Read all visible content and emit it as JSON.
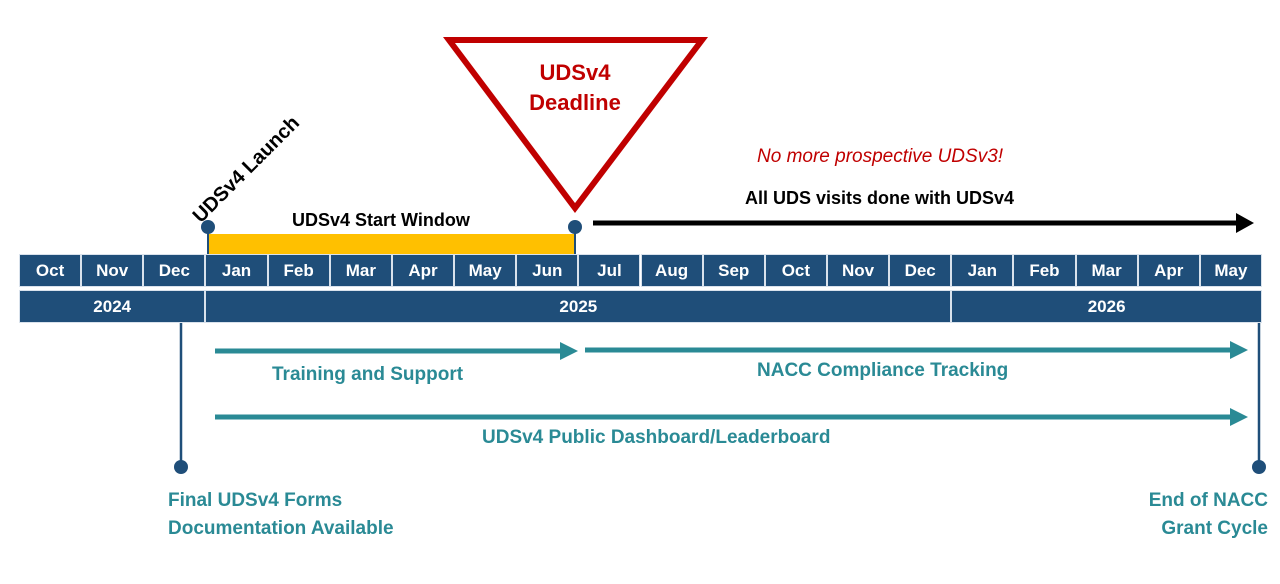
{
  "colors": {
    "navy": "#1f4e79",
    "teal": "#2a8a95",
    "red": "#c00000",
    "yellow": "#ffc000",
    "black": "#000000"
  },
  "timeline": {
    "months": [
      "Oct",
      "Nov",
      "Dec",
      "Jan",
      "Feb",
      "Mar",
      "Apr",
      "May",
      "Jun",
      "Jul",
      "Aug",
      "Sep",
      "Oct",
      "Nov",
      "Dec",
      "Jan",
      "Feb",
      "Mar",
      "Apr",
      "May"
    ],
    "years": [
      {
        "label": "2024",
        "months_spanned": 3
      },
      {
        "label": "2025",
        "months_spanned": 12
      },
      {
        "label": "2026",
        "months_spanned": 5
      }
    ]
  },
  "milestones": {
    "launch": {
      "label": "UDSv4 Launch"
    },
    "deadline": {
      "line1": "UDSv4",
      "line2": "Deadline"
    },
    "final_forms": {
      "line1": "Final UDSv4 Forms",
      "line2": "Documentation Available"
    },
    "end_grant": {
      "line1": "End of NACC",
      "line2": "Grant Cycle"
    }
  },
  "periods": {
    "start_window": {
      "label": "UDSv4 Start Window"
    },
    "all_visits": {
      "label": "All UDS visits done with UDSv4"
    },
    "no_more_v3": {
      "label": "No more prospective UDSv3!"
    },
    "training": {
      "label": "Training and Support"
    },
    "compliance": {
      "label": "NACC Compliance Tracking"
    },
    "dashboard": {
      "label": "UDSv4 Public Dashboard/Leaderboard"
    }
  }
}
